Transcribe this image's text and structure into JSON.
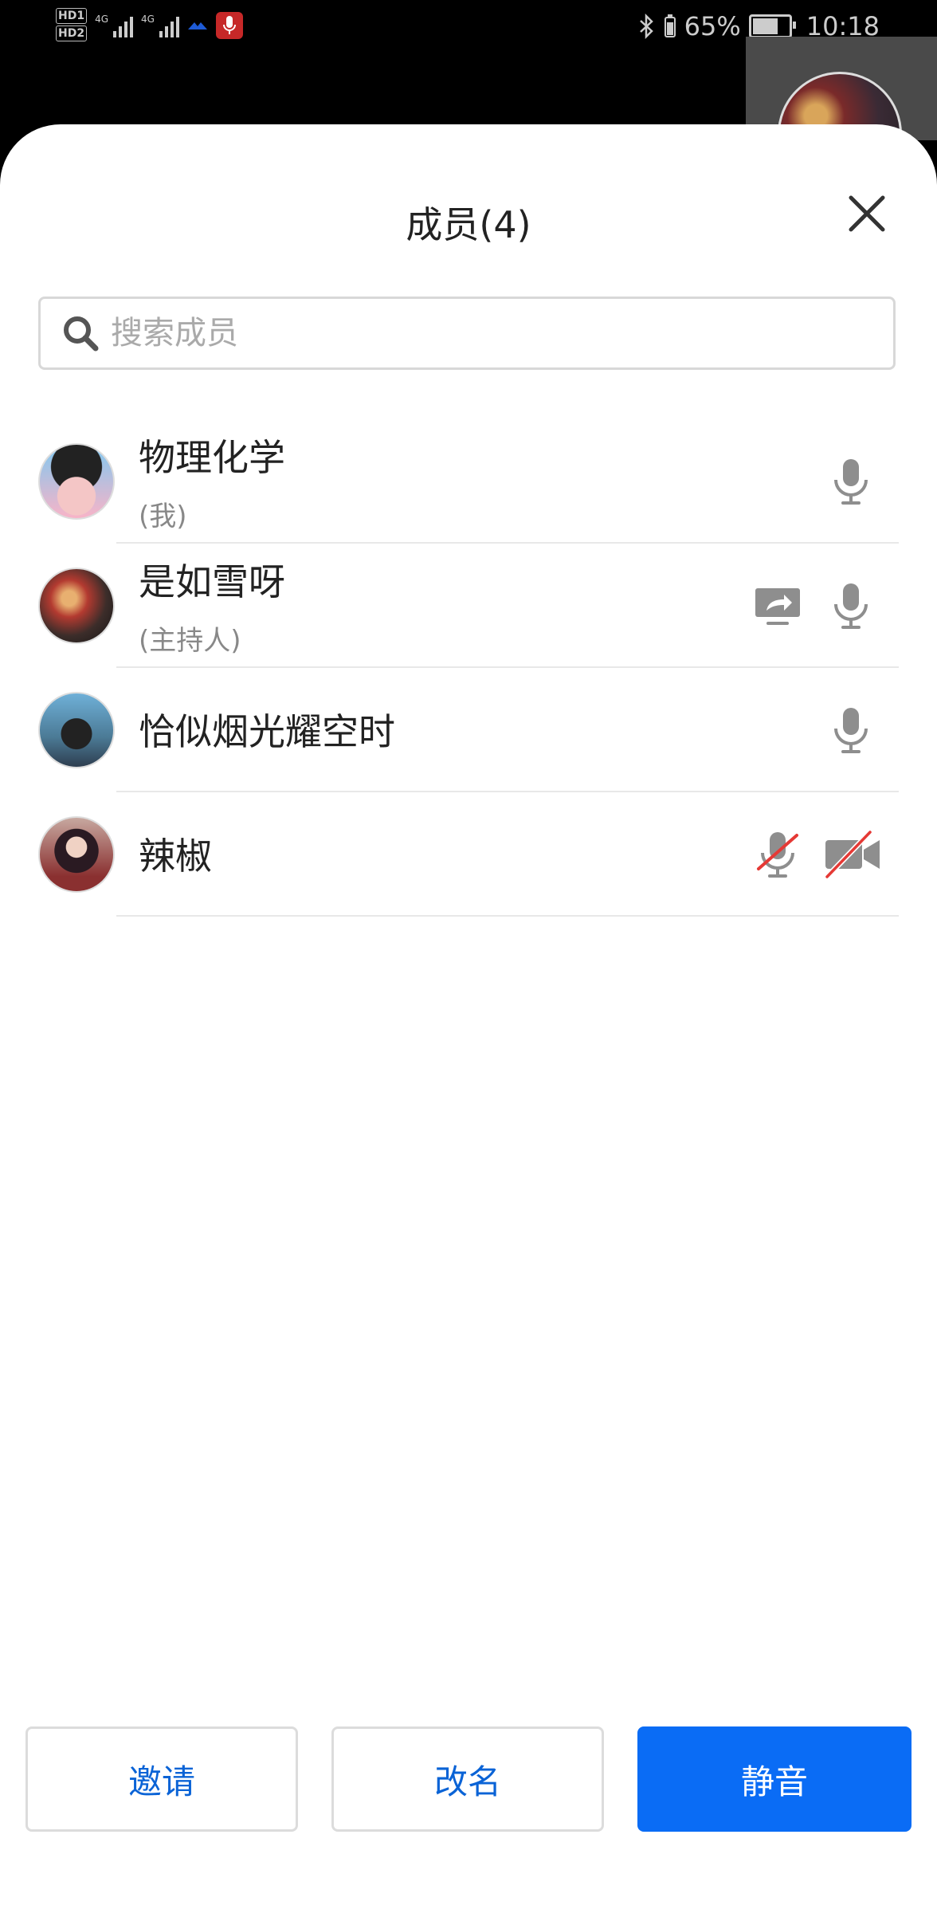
{
  "status_bar": {
    "hd1": "HD1",
    "hd2": "HD2",
    "net1": "4G",
    "net2": "4G",
    "battery": "65%",
    "time": "10:18"
  },
  "header": {
    "title": "成员(4)"
  },
  "search": {
    "placeholder": "搜索成员"
  },
  "members": [
    {
      "name": "物理化学",
      "role": "(我)",
      "mic": "on",
      "sharing": false,
      "camera": "none"
    },
    {
      "name": "是如雪呀",
      "role": "(主持人)",
      "mic": "on",
      "sharing": true,
      "camera": "none"
    },
    {
      "name": "恰似烟光耀空时",
      "role": "",
      "mic": "on",
      "sharing": false,
      "camera": "none"
    },
    {
      "name": "辣椒",
      "role": "",
      "mic": "muted",
      "sharing": false,
      "camera": "off"
    }
  ],
  "actions": {
    "invite": "邀请",
    "rename": "改名",
    "mute": "静音"
  },
  "colors": {
    "accent": "#0a6cf5",
    "icon_gray": "#8e8e8e",
    "disabled_red": "#e53935"
  }
}
